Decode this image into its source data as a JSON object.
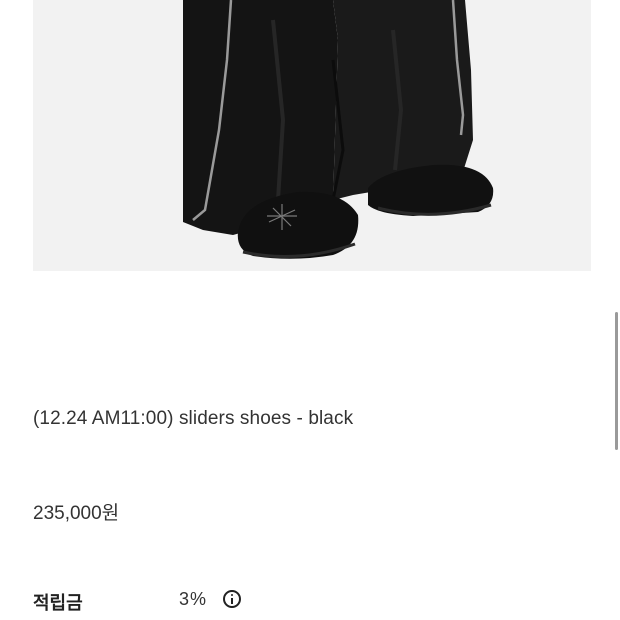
{
  "product": {
    "image_icon": "product-photo-black-pants-suede-shoes",
    "title": "(12.24 AM11:00) sliders shoes - black",
    "price": "235,000원"
  },
  "points": {
    "label": "적립금",
    "value": "3%",
    "info_icon": "info-icon"
  },
  "colors": {
    "background": "#ffffff",
    "text": "#333333",
    "image_background": "#f2f2f2"
  }
}
